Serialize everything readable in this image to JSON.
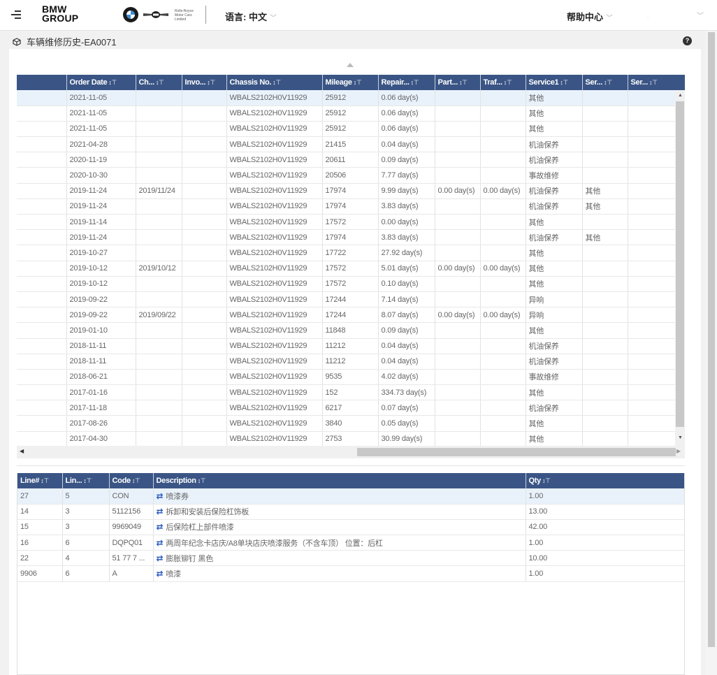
{
  "header": {
    "logo_line1": "BMW",
    "logo_line2": "GROUP",
    "rr_brand": "Rolls-Royce Motor Cars Limited",
    "language": "语言: 中文",
    "help": "帮助中心",
    "user": "."
  },
  "page": {
    "title": "车辆维修历史-EA0071"
  },
  "orders": {
    "columns": [
      "",
      "Order Date",
      "Ch...",
      "Invo...",
      "Chassis No.",
      "Mileage",
      "Repair...",
      "Part...",
      "Traf...",
      "Service1",
      "Ser...",
      "Ser..."
    ],
    "rows": [
      [
        "",
        "2021-11-05",
        "",
        "",
        "WBALS2102H0V11929",
        "25912",
        "0.06 day(s)",
        "",
        "",
        "其他",
        "",
        ""
      ],
      [
        "",
        "2021-11-05",
        "",
        "",
        "WBALS2102H0V11929",
        "25912",
        "0.06 day(s)",
        "",
        "",
        "其他",
        "",
        ""
      ],
      [
        "",
        "2021-11-05",
        "",
        "",
        "WBALS2102H0V11929",
        "25912",
        "0.06 day(s)",
        "",
        "",
        "其他",
        "",
        ""
      ],
      [
        "",
        "2021-04-28",
        "",
        "",
        "WBALS2102H0V11929",
        "21415",
        "0.04 day(s)",
        "",
        "",
        "机油保养",
        "",
        ""
      ],
      [
        "",
        "2020-11-19",
        "",
        "",
        "WBALS2102H0V11929",
        "20611",
        "0.09 day(s)",
        "",
        "",
        "机油保养",
        "",
        ""
      ],
      [
        "",
        "2020-10-30",
        "",
        "",
        "WBALS2102H0V11929",
        "20506",
        "7.77 day(s)",
        "",
        "",
        "事故维修",
        "",
        ""
      ],
      [
        "",
        "2019-11-24",
        "2019/11/24",
        "",
        "WBALS2102H0V11929",
        "17974",
        "9.99 day(s)",
        "0.00 day(s)",
        "0.00 day(s)",
        "机油保养",
        "其他",
        ""
      ],
      [
        "",
        "2019-11-24",
        "",
        "",
        "WBALS2102H0V11929",
        "17974",
        "3.83 day(s)",
        "",
        "",
        "机油保养",
        "其他",
        ""
      ],
      [
        "",
        "2019-11-14",
        "",
        "",
        "WBALS2102H0V11929",
        "17572",
        "0.00 day(s)",
        "",
        "",
        "其他",
        "",
        ""
      ],
      [
        "",
        "2019-11-24",
        "",
        "",
        "WBALS2102H0V11929",
        "17974",
        "3.83 day(s)",
        "",
        "",
        "机油保养",
        "其他",
        ""
      ],
      [
        "",
        "2019-10-27",
        "",
        "",
        "WBALS2102H0V11929",
        "17722",
        "27.92 day(s)",
        "",
        "",
        "其他",
        "",
        ""
      ],
      [
        "",
        "2019-10-12",
        "2019/10/12",
        "",
        "WBALS2102H0V11929",
        "17572",
        "5.01 day(s)",
        "0.00 day(s)",
        "0.00 day(s)",
        "其他",
        "",
        ""
      ],
      [
        "",
        "2019-10-12",
        "",
        "",
        "WBALS2102H0V11929",
        "17572",
        "0.10 day(s)",
        "",
        "",
        "其他",
        "",
        ""
      ],
      [
        "",
        "2019-09-22",
        "",
        "",
        "WBALS2102H0V11929",
        "17244",
        "7.14 day(s)",
        "",
        "",
        "异响",
        "",
        ""
      ],
      [
        "",
        "2019-09-22",
        "2019/09/22",
        "",
        "WBALS2102H0V11929",
        "17244",
        "8.07 day(s)",
        "0.00 day(s)",
        "0.00 day(s)",
        "异响",
        "",
        ""
      ],
      [
        "",
        "2019-01-10",
        "",
        "",
        "WBALS2102H0V11929",
        "11848",
        "0.09 day(s)",
        "",
        "",
        "其他",
        "",
        ""
      ],
      [
        "",
        "2018-11-11",
        "",
        "",
        "WBALS2102H0V11929",
        "11212",
        "0.04 day(s)",
        "",
        "",
        "机油保养",
        "",
        ""
      ],
      [
        "",
        "2018-11-11",
        "",
        "",
        "WBALS2102H0V11929",
        "11212",
        "0.04 day(s)",
        "",
        "",
        "机油保养",
        "",
        ""
      ],
      [
        "",
        "2018-06-21",
        "",
        "",
        "WBALS2102H0V11929",
        "9535",
        "4.02 day(s)",
        "",
        "",
        "事故维修",
        "",
        ""
      ],
      [
        "",
        "2017-01-16",
        "",
        "",
        "WBALS2102H0V11929",
        "152",
        "334.73 day(s)",
        "",
        "",
        "其他",
        "",
        ""
      ],
      [
        "",
        "2017-11-18",
        "",
        "",
        "WBALS2102H0V11929",
        "6217",
        "0.07 day(s)",
        "",
        "",
        "机油保养",
        "",
        ""
      ],
      [
        "",
        "2017-08-26",
        "",
        "",
        "WBALS2102H0V11929",
        "3840",
        "0.05 day(s)",
        "",
        "",
        "其他",
        "",
        ""
      ],
      [
        "",
        "2017-04-30",
        "",
        "",
        "WBALS2102H0V11929",
        "2753",
        "30.99 day(s)",
        "",
        "",
        "其他",
        "",
        ""
      ]
    ]
  },
  "lines": {
    "columns": [
      "Line#",
      "Lin...",
      "Code",
      "Description",
      "Qty"
    ],
    "rows": [
      [
        "27",
        "5",
        "CON",
        "喷漆券",
        "1.00"
      ],
      [
        "14",
        "3",
        "5112156",
        "拆卸和安装后保险杠饰板",
        "13.00"
      ],
      [
        "15",
        "3",
        "9969049",
        "后保险杠上部件喷漆",
        "42.00"
      ],
      [
        "16",
        "6",
        "DQPQ01",
        "两周年纪念卡店庆/A8单块店庆喷漆服务（不含车顶） 位置：后杠",
        "1.00"
      ],
      [
        "22",
        "4",
        "51 77 7 ...",
        "膨胀铆钉 黑色",
        "10.00"
      ],
      [
        "9906",
        "6",
        "A",
        "喷漆",
        "1.00"
      ]
    ]
  },
  "colors": {
    "header_bg": "#3a5585",
    "selected_row": "#e9f2fb",
    "swap_icon": "#2a5bbf"
  }
}
